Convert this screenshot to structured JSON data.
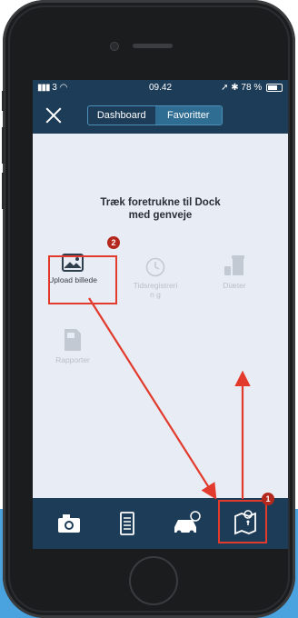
{
  "statusbar": {
    "signal": "3",
    "time": "09.42",
    "battery": "78 %"
  },
  "navbar": {
    "tabs": [
      {
        "label": "Dashboard",
        "active": false
      },
      {
        "label": "Favoritter",
        "active": true
      }
    ]
  },
  "main": {
    "hint_line1": "Træk foretrukne til Dock",
    "hint_line2": "med genveje",
    "tiles": [
      {
        "label": "Upload billede",
        "icon": "image-icon",
        "enabled": true
      },
      {
        "label": "Tidsregistrerin g",
        "icon": "clock-icon",
        "enabled": false
      },
      {
        "label": "Diæter",
        "icon": "coffee-cup-icon",
        "enabled": false
      },
      {
        "label": "Rapporter",
        "icon": "report-icon",
        "enabled": false
      }
    ]
  },
  "dock": {
    "items": [
      {
        "icon": "camera-icon"
      },
      {
        "icon": "document-icon"
      },
      {
        "icon": "car-icon"
      },
      {
        "icon": "map-pin-icon"
      }
    ]
  },
  "annotations": {
    "badge_1": "1",
    "badge_2": "2",
    "color": "#e23a2c"
  },
  "colors": {
    "navbar": "#1d3c57",
    "content_bg": "#e8ecf4",
    "accent": "#2f6d92"
  }
}
